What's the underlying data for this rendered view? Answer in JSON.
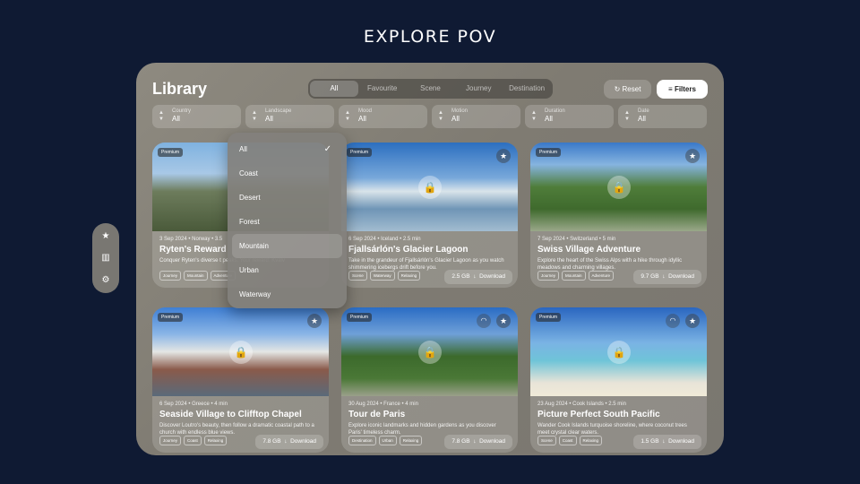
{
  "brand": "EXPLORE POV",
  "library": {
    "title": "Library",
    "segments": [
      "All",
      "Favourite",
      "Scene",
      "Journey",
      "Destination"
    ],
    "reset": "Reset",
    "filters_btn": "Filters",
    "filters": [
      {
        "label": "Country",
        "value": "All"
      },
      {
        "label": "Landscape",
        "value": "All"
      },
      {
        "label": "Mood",
        "value": "All"
      },
      {
        "label": "Motion",
        "value": "All"
      },
      {
        "label": "Duration",
        "value": "All"
      },
      {
        "label": "Date",
        "value": "All"
      }
    ]
  },
  "dropdown": {
    "options": [
      "All",
      "Coast",
      "Desert",
      "Forest",
      "Mountain",
      "Urban",
      "Waterway"
    ],
    "selected": "All",
    "hovered": "Mountain"
  },
  "cards": [
    {
      "premium": "Premium",
      "meta": "3 Sep 2024 • Norway • 3.5",
      "title": "Ryten's Reward",
      "desc": "Conquer Ryten's diverse t peaks. Your reward: Kvalv",
      "tags": [
        "Journey",
        "Mountain",
        "Adventure"
      ],
      "size": "",
      "download": ""
    },
    {
      "premium": "Premium",
      "meta": "6 Sep 2024 • Iceland • 2.5 min",
      "title": "Fjallsárlón's Glacier Lagoon",
      "desc": "Take in the grandeur of Fjallsárlón's Glacier Lagoon as you watch shimmering icebergs drift before you.",
      "tags": [
        "Scene",
        "Waterway",
        "Relaxing"
      ],
      "size": "2.5 GB",
      "download": "Download"
    },
    {
      "premium": "Premium",
      "meta": "7 Sep 2024 • Switzerland • 5 min",
      "title": "Swiss Village Adventure",
      "desc": "Explore the heart of the Swiss Alps with a hike through idyllic meadows and charming villages.",
      "tags": [
        "Journey",
        "Mountain",
        "Adventure"
      ],
      "size": "9.7 GB",
      "download": "Download"
    },
    {
      "premium": "Premium",
      "meta": "6 Sep 2024 • Greece • 4 min",
      "title": "Seaside Village to Clifftop Chapel",
      "desc": "Discover Loutro's beauty, then follow a dramatic coastal path to a church with endless blue views.",
      "tags": [
        "Journey",
        "Coast",
        "Relaxing"
      ],
      "size": "7.8 GB",
      "download": "Download"
    },
    {
      "premium": "Premium",
      "meta": "30 Aug 2024 • France • 4 min",
      "title": "Tour de Paris",
      "desc": "Explore iconic landmarks and hidden gardens as you discover Paris' timeless charm.",
      "tags": [
        "Destination",
        "Urban",
        "Relaxing"
      ],
      "size": "7.8 GB",
      "download": "Download"
    },
    {
      "premium": "Premium",
      "meta": "23 Aug 2024 • Cook Islands • 2.5 min",
      "title": "Picture Perfect South Pacific",
      "desc": "Wander Cook Islands turquoise shoreline, where coconut trees meet crystal clear waters.",
      "tags": [
        "Scene",
        "Coast",
        "Relaxing"
      ],
      "size": "1.5 GB",
      "download": "Download"
    }
  ],
  "sidebar": {
    "icons": [
      "star-icon",
      "library-icon",
      "settings-icon"
    ]
  }
}
